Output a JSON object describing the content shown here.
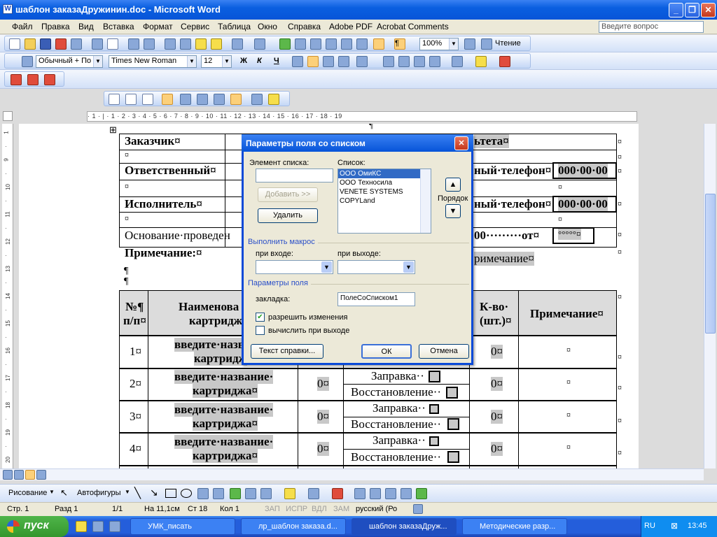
{
  "window": {
    "title": "шаблон заказаДружинин.doc - Microsoft Word"
  },
  "menu": {
    "items": [
      "Файл",
      "Правка",
      "Вид",
      "Вставка",
      "Формат",
      "Сервис",
      "Таблица",
      "Окно",
      "Справка",
      "Adobe PDF",
      "Acrobat Comments"
    ],
    "ask_placeholder": "Введите вопрос"
  },
  "toolbar": {
    "zoom": "100%",
    "reading": "Чтение",
    "style": "Обычный + По ц",
    "font": "Times New Roman",
    "size": "12",
    "bold": "Ж",
    "italic": "К",
    "underline": "Ч"
  },
  "ruler": {
    "marks": "· 1 · | · 1 · 2 · 3 · 4 · 5 · 6 · 7 · 8 · 9 · 10 · 11 · 12 · 13 · 14 · 15 · 16 · 17 · 18 · 19"
  },
  "document": {
    "customer": "Заказчик¤",
    "responsible": "Ответственный¤",
    "executor": "Исполнитель¤",
    "basis": "Основание·проведен",
    "note": "Примечание:¤",
    "right1": "ьтета¤",
    "right2": "ный·телефон¤",
    "right3": "ный·телефон¤",
    "phone1": "000·00·00",
    "phone2": "000·00·00",
    "basis_right": "00·········от¤",
    "basis_field": "°°°°°¤",
    "note_right": "римечание¤",
    "pilcrow": "¶",
    "small_mark": "¤",
    "table_head": {
      "num": "№¶",
      "num2": "п/п¤",
      "name": "Наименова",
      "name2": "картридж",
      "qty": "К-во·",
      "qty2": "(шт.)¤",
      "note": "Примечание¤"
    },
    "rows": [
      {
        "num": "1¤",
        "name": "введите·назв",
        "name2": "картридж",
        "qty": "0¤",
        "note": "¤"
      },
      {
        "num": "2¤",
        "name": "введите·название·",
        "name2": "картриджа¤",
        "zero": "0¤",
        "refill": "Заправка··",
        "restore": "Восстановление··",
        "qty": "0¤",
        "note": "¤"
      },
      {
        "num": "3¤",
        "name": "введите·название·",
        "name2": "картриджа¤",
        "zero": "0¤",
        "refill": "Заправка··",
        "restore": "Восстановление··",
        "qty": "0¤",
        "note": "¤"
      },
      {
        "num": "4¤",
        "name": "введите·название·",
        "name2": "картриджа¤",
        "zero": "0¤",
        "refill": "Заправка··",
        "restore": "Восстановление··",
        "qty": "0¤",
        "note": "¤"
      }
    ]
  },
  "dialog": {
    "title": "Параметры поля со списком",
    "item_label": "Элемент списка:",
    "item_value": "",
    "list_label": "Список:",
    "add": "Добавить  >>",
    "remove": "Удалить",
    "order": "Порядок",
    "list_items": [
      "ООО ОмиКС",
      "ООО Техносила",
      "VENETE SYSTEMS",
      "COPYLand"
    ],
    "macro_section": "Выполнить макрос",
    "on_entry": "при входе:",
    "on_exit": "при выходе:",
    "field_section": "Параметры поля",
    "bookmark_label": "закладка:",
    "bookmark_value": "ПолеСоСписком1",
    "allow_changes": "разрешить изменения",
    "calc_on_exit": "вычислить при выходе",
    "help_text": "Текст справки...",
    "ok": "ОК",
    "cancel": "Отмена"
  },
  "drawbar": {
    "draw": "Рисование",
    "autoshapes": "Автофигуры"
  },
  "status": {
    "page": "Стр.  1",
    "section": "Разд  1",
    "pages": "1/1",
    "at": "На 11,1см",
    "line": "Ст  18",
    "col": "Кол  1",
    "rec": "ЗАП",
    "trk": "ИСПР",
    "ext": "ВДЛ",
    "ovr": "ЗАМ",
    "lang": "русский (Ро"
  },
  "taskbar": {
    "start": "пуск",
    "tasks": [
      "УМК_писать",
      "лр_шаблон заказа.d...",
      "шаблон заказаДруж...",
      "Методические разр..."
    ],
    "lang": "RU",
    "time": "13:45"
  },
  "colors": {
    "accent": "#0a5fe0",
    "dialog_title": "#0754d8",
    "field_shading": "#c8c8c8",
    "selection": "#316ac5"
  }
}
